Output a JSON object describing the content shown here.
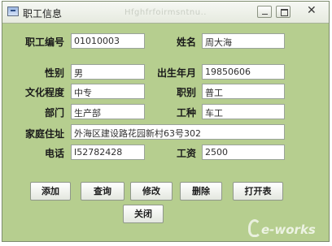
{
  "window": {
    "title": "职工信息",
    "ghost_title": "Hfghfrfoirmsntnu..",
    "close_glyph": "✕"
  },
  "form": {
    "employee_id": {
      "label": "职工编号",
      "value": "01010003"
    },
    "name": {
      "label": "姓名",
      "value": "周大海"
    },
    "gender": {
      "label": "性别",
      "value": "男"
    },
    "birth": {
      "label": "出生年月",
      "value": "19850606"
    },
    "education": {
      "label": "文化程度",
      "value": "中专"
    },
    "title": {
      "label": "职别",
      "value": "普工"
    },
    "department": {
      "label": "部门",
      "value": "生产部"
    },
    "job_type": {
      "label": "工种",
      "value": "车工"
    },
    "address": {
      "label": "家庭住址",
      "value": "外海区建设路花园新村63号302"
    },
    "phone": {
      "label": "电话",
      "value": "I52782428"
    },
    "salary": {
      "label": "工资",
      "value": "2500"
    }
  },
  "buttons": {
    "add": "添加",
    "query": "查询",
    "modify": "修改",
    "delete": "删除",
    "open_table": "打开表",
    "close": "关闭"
  },
  "watermark": {
    "text": "e-works"
  },
  "colors": {
    "window_bg": "#b6ce8f",
    "field_bg": "#ffffff"
  }
}
